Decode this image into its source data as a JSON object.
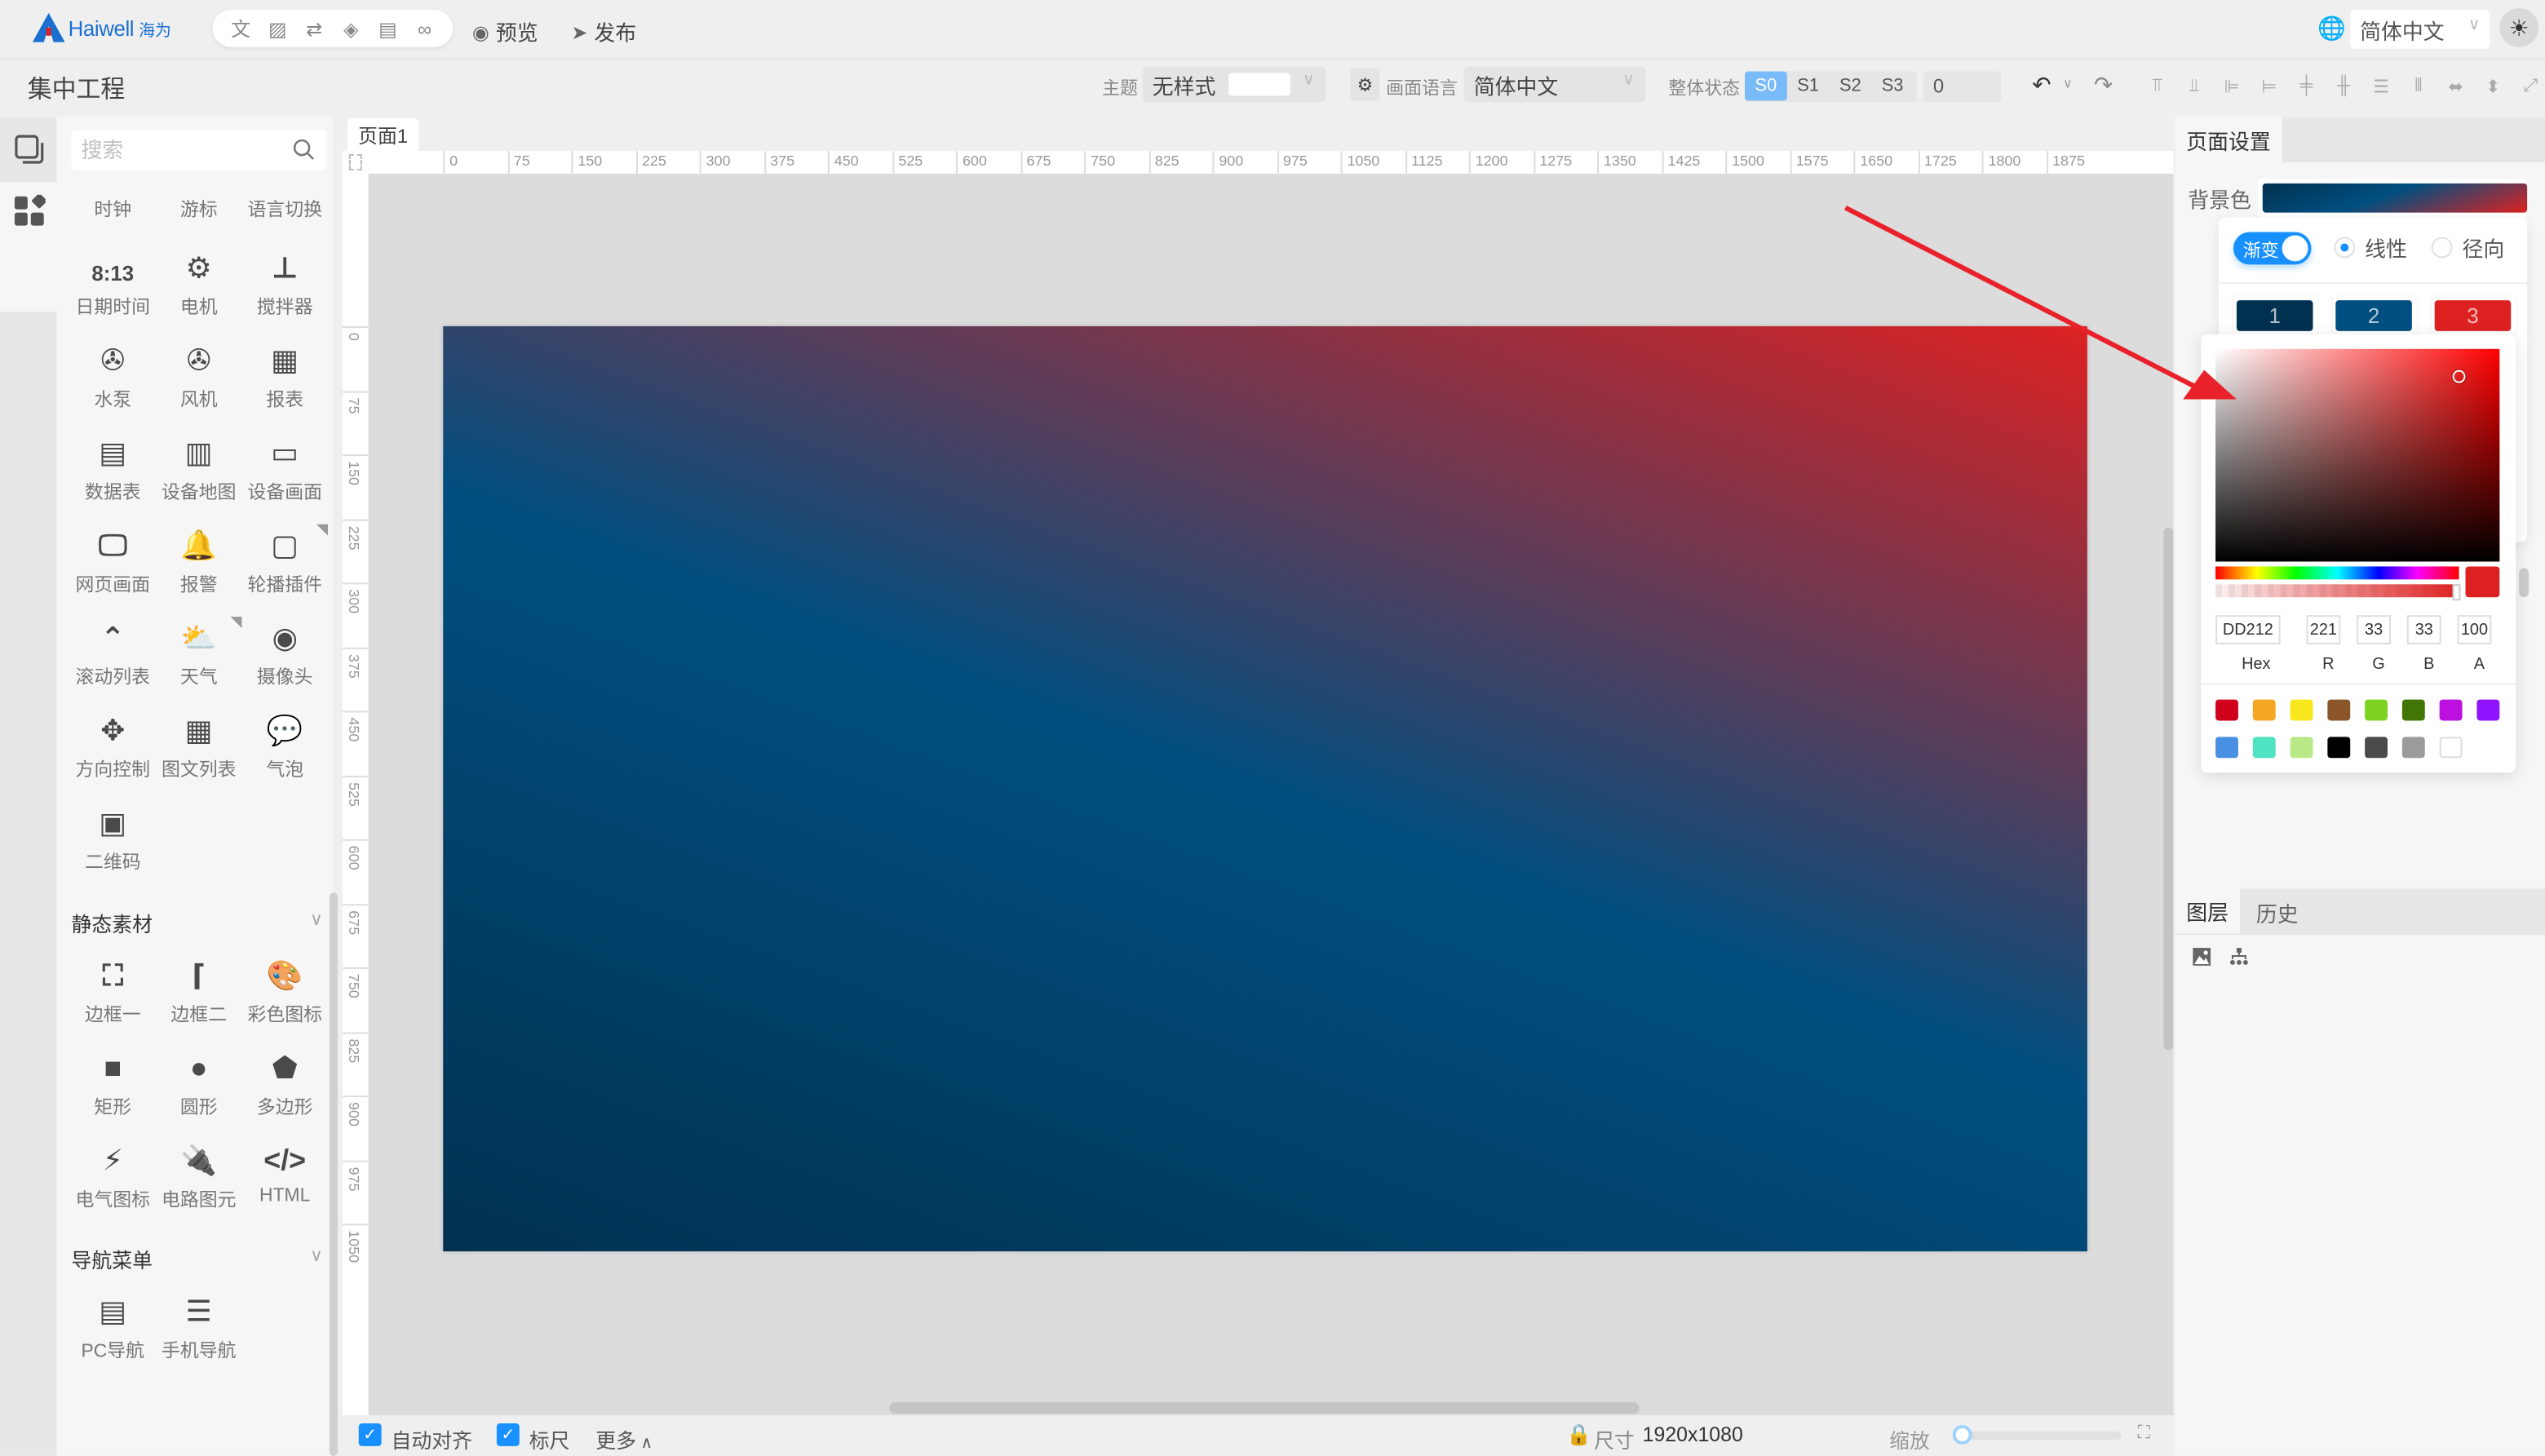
{
  "header": {
    "brand": "Haiwell",
    "brand_cn": "海为",
    "tools": [
      {
        "icon": "translate-icon",
        "glyph": "文"
      },
      {
        "icon": "image-icon",
        "glyph": "▨"
      },
      {
        "icon": "variable-icon",
        "glyph": "⇄"
      },
      {
        "icon": "layers-icon",
        "glyph": "◈"
      },
      {
        "icon": "document-icon",
        "glyph": "▤"
      },
      {
        "icon": "link-icon",
        "glyph": "🔗"
      }
    ],
    "preview_label": "预览",
    "publish_label": "发布",
    "language": "简体中文"
  },
  "toolbar": {
    "project_title": "集中工程",
    "theme_label": "主题",
    "theme_value": "无样式",
    "screen_lang_label": "画面语言",
    "screen_lang_value": "简体中文",
    "state_label": "整体状态",
    "states": [
      "S0",
      "S1",
      "S2",
      "S3"
    ],
    "active_state": "S0",
    "state_value": "0"
  },
  "library": {
    "search_placeholder": "搜索",
    "components": [
      {
        "label": "时钟",
        "icon": "clock-icon"
      },
      {
        "label": "游标",
        "icon": "cursor-icon"
      },
      {
        "label": "语言切换",
        "icon": "language-switch-icon"
      },
      {
        "label": "日期时间",
        "icon": "datetime-icon",
        "glyph": "8:13"
      },
      {
        "label": "电机",
        "icon": "motor-icon"
      },
      {
        "label": "搅拌器",
        "icon": "mixer-icon"
      },
      {
        "label": "水泵",
        "icon": "pump-icon"
      },
      {
        "label": "风机",
        "icon": "fan-icon"
      },
      {
        "label": "报表",
        "icon": "report-icon"
      },
      {
        "label": "数据表",
        "icon": "data-table-icon"
      },
      {
        "label": "设备地图",
        "icon": "device-map-icon"
      },
      {
        "label": "设备画面",
        "icon": "device-screen-icon"
      },
      {
        "label": "网页画面",
        "icon": "web-page-icon"
      },
      {
        "label": "报警",
        "icon": "alarm-bell-icon"
      },
      {
        "label": "轮播插件",
        "icon": "carousel-icon"
      },
      {
        "label": "滚动列表",
        "icon": "scroll-list-icon"
      },
      {
        "label": "天气",
        "icon": "weather-icon"
      },
      {
        "label": "摄像头",
        "icon": "camera-icon"
      },
      {
        "label": "方向控制",
        "icon": "direction-control-icon"
      },
      {
        "label": "图文列表",
        "icon": "image-text-list-icon"
      },
      {
        "label": "气泡",
        "icon": "bubble-icon"
      },
      {
        "label": "二维码",
        "icon": "qrcode-icon"
      }
    ],
    "static_section": "静态素材",
    "static_items": [
      {
        "label": "边框一",
        "icon": "border-one-icon"
      },
      {
        "label": "边框二",
        "icon": "border-two-icon"
      },
      {
        "label": "彩色图标",
        "icon": "color-icon-palette"
      },
      {
        "label": "矩形",
        "icon": "rectangle-icon"
      },
      {
        "label": "圆形",
        "icon": "circle-icon"
      },
      {
        "label": "多边形",
        "icon": "polygon-icon"
      },
      {
        "label": "电气图标",
        "icon": "electrical-icon"
      },
      {
        "label": "电路图元",
        "icon": "circuit-plug-icon"
      },
      {
        "label": "HTML",
        "icon": "html-code-icon"
      }
    ],
    "nav_section": "导航菜单",
    "nav_items": [
      {
        "label": "PC导航",
        "icon": "pc-nav-icon"
      },
      {
        "label": "手机导航",
        "icon": "mobile-nav-icon"
      }
    ]
  },
  "workspace": {
    "page_tab": "页面1",
    "ruler_h": [
      "0",
      "75",
      "150",
      "225",
      "300",
      "375",
      "450",
      "525",
      "600",
      "675",
      "750",
      "825",
      "900",
      "975",
      "1050",
      "1125",
      "1200",
      "1275",
      "1350",
      "1425",
      "1500",
      "1575",
      "1650",
      "1725",
      "1800",
      "1875"
    ],
    "ruler_v": [
      "0",
      "75",
      "150",
      "225",
      "300",
      "375",
      "450",
      "525",
      "600",
      "675",
      "750",
      "825",
      "900",
      "975",
      "1050"
    ],
    "canvas_gradient": {
      "type": "linear",
      "stops": [
        "#003150",
        "#004F80",
        "#DD2121"
      ]
    }
  },
  "bottom": {
    "auto_align_label": "自动对齐",
    "auto_align_checked": true,
    "ruler_label": "标尺",
    "ruler_checked": true,
    "more_label": "更多",
    "size_label": "尺寸",
    "size_value": "1920x1080",
    "zoom_label": "缩放",
    "zoom_value": 0.02
  },
  "right_panel": {
    "tab": "页面设置",
    "bg_label": "背景色",
    "gradient_toggle_label": "渐变",
    "gradient_on": true,
    "mode_linear": "线性",
    "mode_radial": "径向",
    "selected_mode": "线性",
    "stops": [
      {
        "label": "1",
        "color": "#003150"
      },
      {
        "label": "2",
        "color": "#004F80"
      },
      {
        "label": "3",
        "color": "#DD2121"
      }
    ],
    "picker": {
      "hex": "DD212",
      "r": "221",
      "g": "33",
      "b": "33",
      "a": "100",
      "hex_label": "Hex",
      "r_label": "R",
      "g_label": "G",
      "b_label": "B",
      "a_label": "A",
      "current_color": "#DD2121",
      "presets": [
        "#D0021B",
        "#F5A623",
        "#F8E71C",
        "#8B572A",
        "#7ED321",
        "#417505",
        "#BD10E0",
        "#9013FE",
        "#4A90E2",
        "#50E3C2",
        "#B8E986",
        "#000000",
        "#4A4A4A",
        "#9B9B9B",
        "#FFFFFF"
      ]
    },
    "layers_tab": "图层",
    "history_tab": "历史"
  }
}
